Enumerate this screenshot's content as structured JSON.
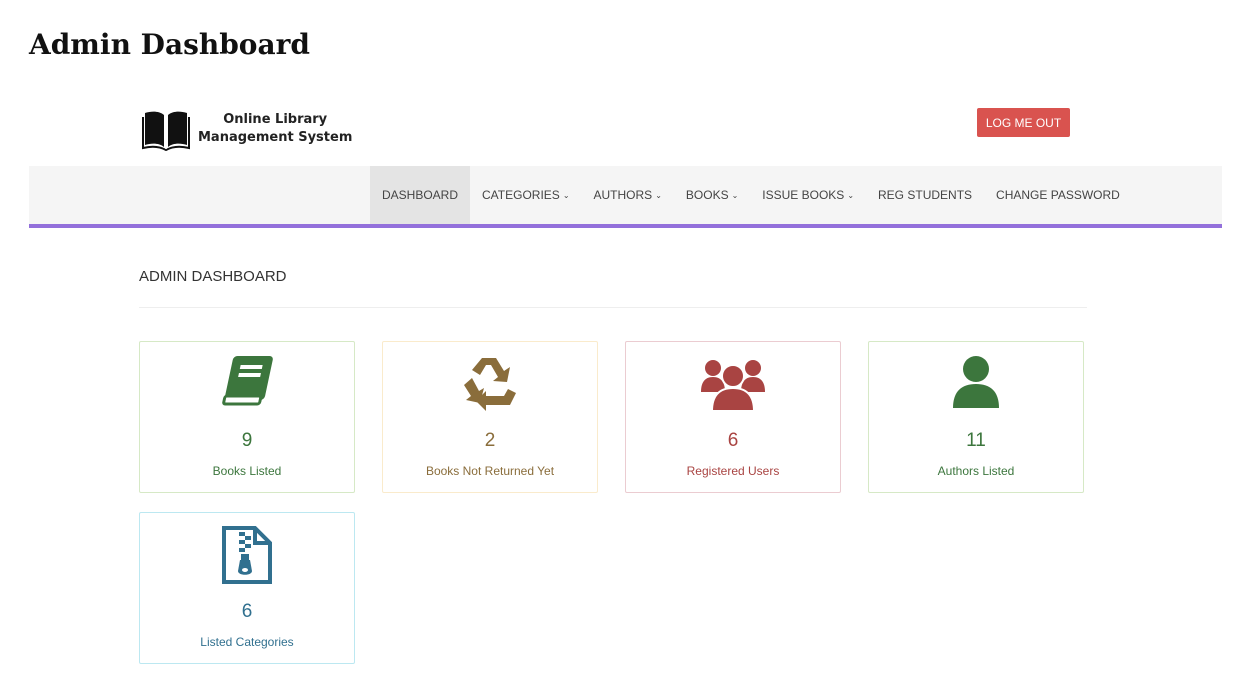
{
  "page": {
    "title": "Admin Dashboard"
  },
  "header": {
    "logo_line1": "Online Library",
    "logo_line2": "Management System",
    "logout_label": "LOG ME OUT",
    "logout_color": "#d9534f"
  },
  "nav": {
    "accent_color": "#9370DB",
    "items": [
      {
        "label": "DASHBOARD",
        "active": true
      },
      {
        "label": "CATEGORIES",
        "dropdown": true
      },
      {
        "label": "AUTHORS",
        "dropdown": true
      },
      {
        "label": "BOOKS",
        "dropdown": true
      },
      {
        "label": "ISSUE BOOKS",
        "dropdown": true
      },
      {
        "label": "REG STUDENTS"
      },
      {
        "label": "CHANGE PASSWORD"
      }
    ]
  },
  "dashboard": {
    "heading": "ADMIN DASHBOARD",
    "cards": [
      {
        "count": "9",
        "label": "Books Listed",
        "icon": "book-icon",
        "color": "#3c763d",
        "border": "#d6e9c6"
      },
      {
        "count": "2",
        "label": "Books Not Returned Yet",
        "icon": "recycle-icon",
        "color": "#8a6d3b",
        "border": "#faebcc"
      },
      {
        "count": "6",
        "label": "Registered Users",
        "icon": "users-icon",
        "color": "#a94442",
        "border": "#ebccd1"
      },
      {
        "count": "11",
        "label": "Authors Listed",
        "icon": "user-icon",
        "color": "#3c763d",
        "border": "#d6e9c6"
      },
      {
        "count": "6",
        "label": "Listed Categories",
        "icon": "file-archive-icon",
        "color": "#31708f",
        "border": "#bce8f1"
      }
    ]
  }
}
